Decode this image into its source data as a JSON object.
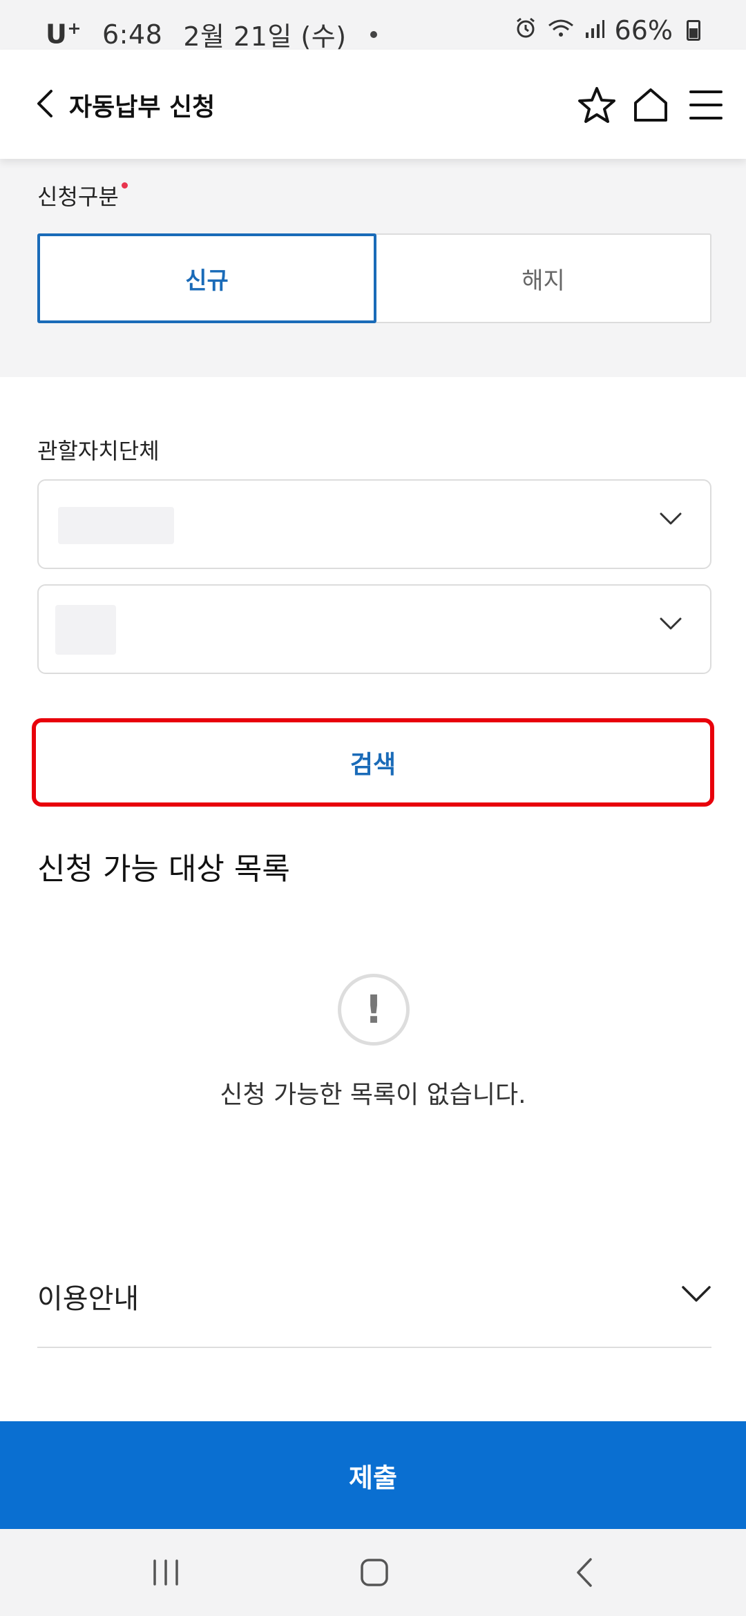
{
  "status_bar": {
    "carrier": "U",
    "carrier_sup": "+",
    "time": "6:48",
    "date": "2월 21일 (수)",
    "battery": "66%"
  },
  "header": {
    "title": "자동납부 신청",
    "icons": [
      "back-icon",
      "star-icon",
      "home-icon",
      "menu-icon"
    ]
  },
  "application_type": {
    "label": "신청구분",
    "options": [
      "신규",
      "해지"
    ],
    "selected": "신규"
  },
  "jurisdiction": {
    "label": "관할자치단체"
  },
  "search_button": {
    "label": "검색"
  },
  "results": {
    "title": "신청 가능 대상 목록",
    "empty_icon_glyph": "!",
    "empty_message": "신청 가능한 목록이 없습니다."
  },
  "guide": {
    "label": "이용안내"
  },
  "submit_button": {
    "label": "제출"
  },
  "colors": {
    "accent": "#1a6bb8",
    "submit": "#0a6fd1",
    "highlight": "#e8000b",
    "required": "#e8344e"
  }
}
